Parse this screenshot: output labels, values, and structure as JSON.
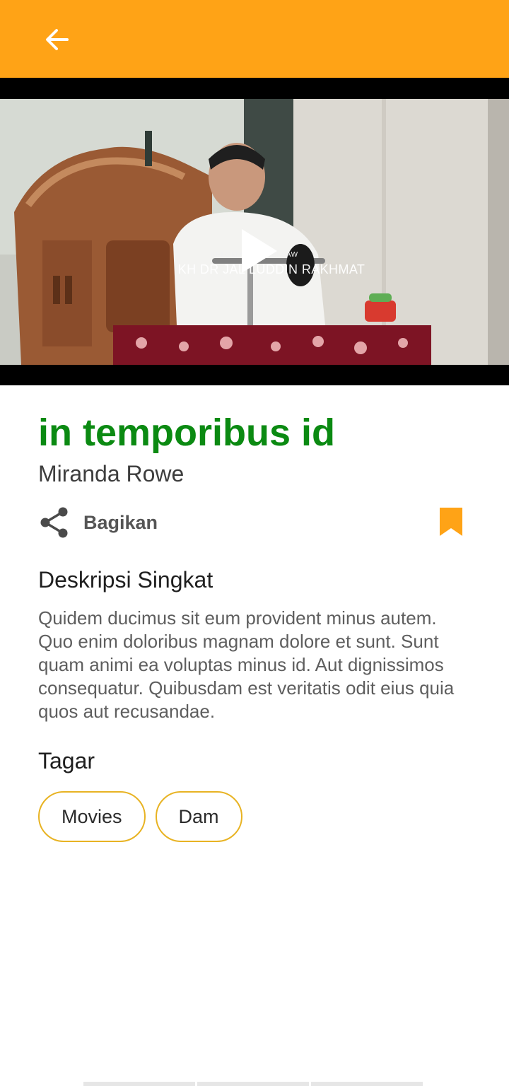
{
  "colors": {
    "app_bar": "#FFA316",
    "title": "#0B8A12",
    "tag_border": "#E8B323",
    "bookmark": "#FFA316"
  },
  "header": {
    "back_icon": "arrow-left-icon"
  },
  "video": {
    "overlay_small": "KELOM         ABAT NABI SAW",
    "overlay_big": "KH DR JAL  LUDDIN RAKHMAT",
    "play_icon": "play-icon"
  },
  "item": {
    "title": "in temporibus id",
    "author": "Miranda Rowe"
  },
  "actions": {
    "share_label": "Bagikan",
    "share_icon": "share-icon",
    "bookmark_icon": "bookmark-icon"
  },
  "description": {
    "heading": "Deskripsi Singkat",
    "text": "Quidem ducimus sit eum provident minus autem. Quo enim doloribus magnam dolore et sunt. Sunt quam animi ea voluptas minus id. Aut dignissimos consequatur. Quibusdam est veritatis odit eius quia quos aut recusandae."
  },
  "tags": {
    "heading": "Tagar",
    "items": [
      "Movies",
      "Dam"
    ]
  }
}
